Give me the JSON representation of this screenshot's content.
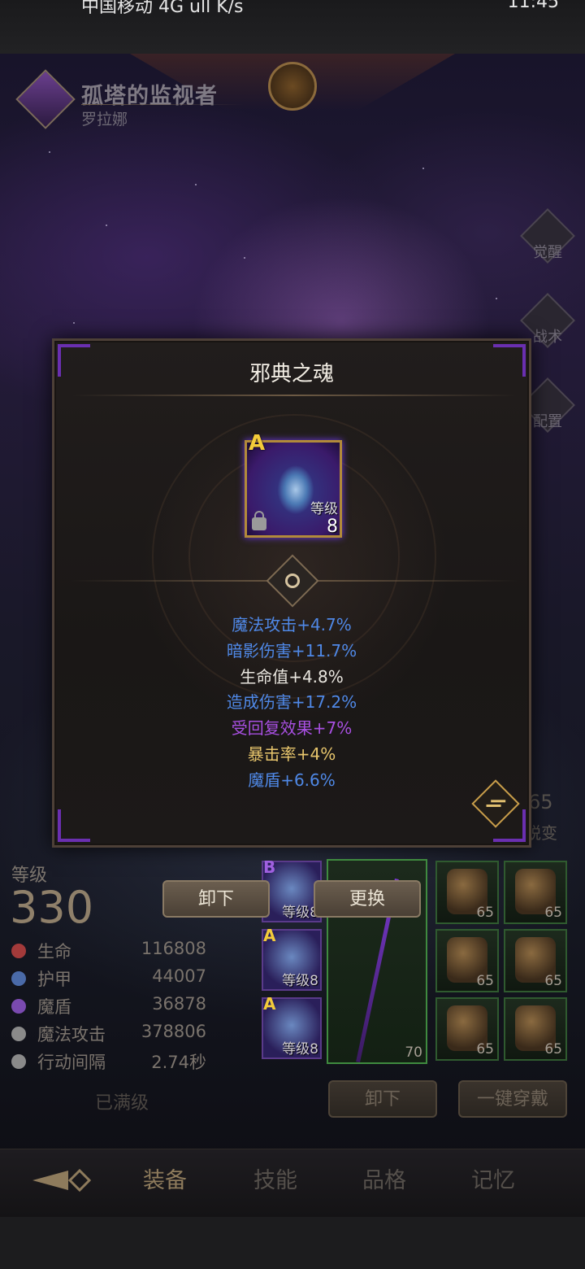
{
  "status_bar": {
    "left": "中国移动 4G ull K/s",
    "right": "11:45"
  },
  "hero": {
    "title": "孤塔的监视者",
    "name": "罗拉娜"
  },
  "side_buttons": [
    "觉醒",
    "战术",
    "配置"
  ],
  "modal": {
    "title": "邪典之魂",
    "item": {
      "grade": "A",
      "level_label": "等级",
      "level": "8",
      "icon": "skull-hood-icon"
    },
    "stats": [
      {
        "text": "魔法攻击+4.7%",
        "tone": "blue"
      },
      {
        "text": "暗影伤害+11.7%",
        "tone": "blue"
      },
      {
        "text": "生命值+4.8%",
        "tone": "white"
      },
      {
        "text": "造成伤害+17.2%",
        "tone": "blue"
      },
      {
        "text": "受回复效果+7%",
        "tone": "purple"
      },
      {
        "text": "暴击率+4%",
        "tone": "gold"
      },
      {
        "text": "魔盾+6.6%",
        "tone": "blue"
      }
    ],
    "unequip_label": "卸下",
    "replace_label": "更换"
  },
  "level": {
    "label": "等级",
    "value": "330"
  },
  "attributes": [
    {
      "label": "生命",
      "value": "116808",
      "icon": "cross-icon",
      "color": "#a33a3a"
    },
    {
      "label": "护甲",
      "value": "44007",
      "icon": "shield-icon",
      "color": "#4a6aa8"
    },
    {
      "label": "魔盾",
      "value": "36878",
      "icon": "swirl-icon",
      "color": "#7a4ab0"
    },
    {
      "label": "魔法攻击",
      "value": "378806",
      "icon": "wand-icon",
      "color": "#9a9a9a"
    },
    {
      "label": "行动间隔",
      "value": "2.74秒",
      "icon": "wing-icon",
      "color": "#9a9a9a"
    }
  ],
  "maxed_label": "已满级",
  "runes": [
    {
      "grade": "B",
      "level": "等级8"
    },
    {
      "grade": "A",
      "level": "等级8"
    },
    {
      "grade": "A",
      "level": "等级8"
    }
  ],
  "weapon": {
    "level": "70"
  },
  "gear": [
    "65",
    "65",
    "65",
    "65",
    "65",
    "65"
  ],
  "side_level": {
    "value": "65",
    "label": "蜕变"
  },
  "actions": {
    "unequip_all": "卸下",
    "one_click_equip": "一键穿戴"
  },
  "tabs": [
    "装备",
    "技能",
    "品格",
    "记忆"
  ],
  "colors": {
    "accent": "#6a2fb0",
    "gold": "#b28a3a",
    "stat_blue": "#4f88e6"
  }
}
